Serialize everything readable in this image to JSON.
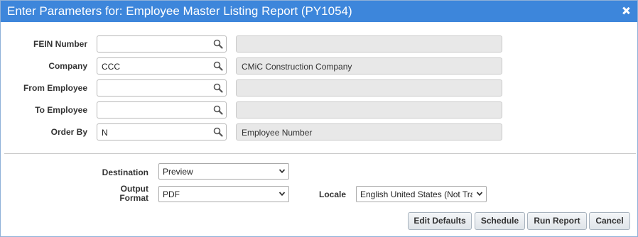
{
  "window": {
    "title": "Enter Parameters for: Employee Master Listing Report (PY1054)"
  },
  "parameters": [
    {
      "label": "FEIN Number",
      "value": "",
      "description": ""
    },
    {
      "label": "Company",
      "value": "CCC",
      "description": "CMiC Construction Company"
    },
    {
      "label": "From Employee",
      "value": "",
      "description": ""
    },
    {
      "label": "To Employee",
      "value": "",
      "description": ""
    },
    {
      "label": "Order By",
      "value": "N",
      "description": "Employee Number"
    }
  ],
  "output": {
    "destination_label": "Destination",
    "destination_value": "Preview",
    "format_label_line1": "Output",
    "format_label_line2": "Format",
    "format_value": "PDF",
    "locale_label": "Locale",
    "locale_value": "English United States (Not Tra"
  },
  "buttons": {
    "edit_defaults": "Edit Defaults",
    "schedule": "Schedule",
    "run_report": "Run Report",
    "cancel": "Cancel"
  },
  "icons": {
    "lookup": "magnifier-icon",
    "dropdown": "chevron-down-icon",
    "close": "close-icon"
  },
  "colors": {
    "titlebar": "#3d86db",
    "readonly_field": "#e8e8e8"
  }
}
